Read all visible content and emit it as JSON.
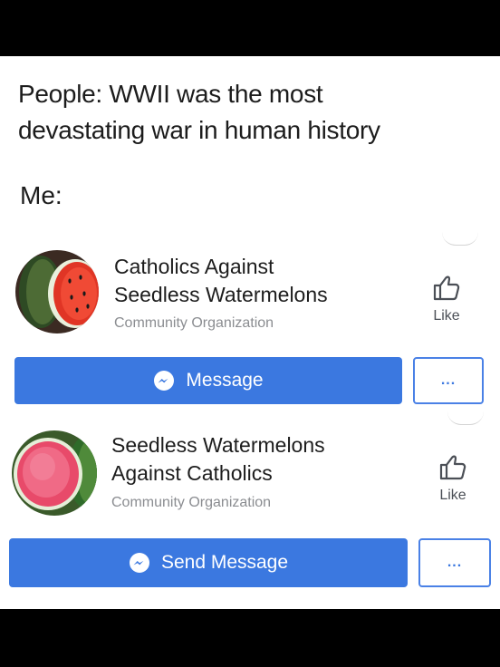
{
  "meme": {
    "line1": "People: WWII was the most",
    "line2": "devastating war in human history",
    "me": "Me:"
  },
  "cards": [
    {
      "name_line1": "Catholics Against",
      "name_line2": "Seedless Watermelons",
      "category": "Community Organization",
      "like_label": "Like",
      "primary_button": "Message",
      "more_button": "...",
      "avatar_icon": "watermelon-with-seeds-icon"
    },
    {
      "name_line1": "Seedless Watermelons",
      "name_line2": "Against Catholics",
      "category": "Community Organization",
      "like_label": "Like",
      "primary_button": "Send Message",
      "more_button": "...",
      "avatar_icon": "seedless-watermelon-icon"
    }
  ],
  "colors": {
    "button_blue": "#3b78e0",
    "category_gray": "#8b8d91",
    "frame_black": "#000000"
  }
}
